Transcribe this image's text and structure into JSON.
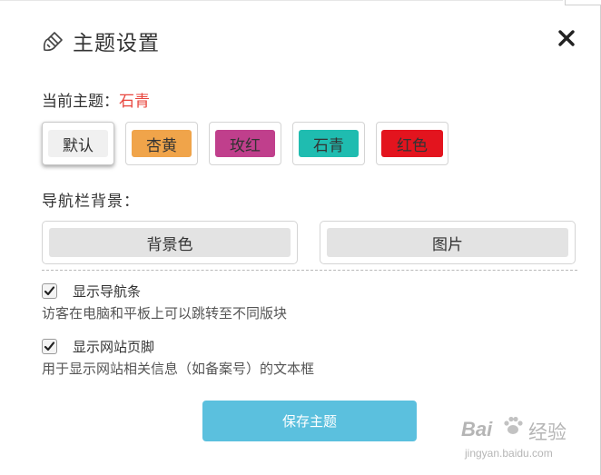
{
  "dialog": {
    "title": "主题设置",
    "icons": {
      "title": "paint-brush-icon",
      "close": "close-icon"
    }
  },
  "current_theme": {
    "label": "当前主题：",
    "value": "石青",
    "value_color": "#e8463e"
  },
  "themes": [
    {
      "label": "默认",
      "color": "#f0f0f0",
      "selected": true
    },
    {
      "label": "杏黄",
      "color": "#f0a44a",
      "selected": false
    },
    {
      "label": "玫红",
      "color": "#c03f8c",
      "selected": false
    },
    {
      "label": "石青",
      "color": "#1fbcb0",
      "selected": false
    },
    {
      "label": "红色",
      "color": "#e3141e",
      "selected": false
    }
  ],
  "nav_background": {
    "label": "导航栏背景：",
    "options": [
      {
        "label": "背景色"
      },
      {
        "label": "图片"
      }
    ]
  },
  "options": [
    {
      "label": "显示导航条",
      "checked": true,
      "description": "访客在电脑和平板上可以跳转至不同版块"
    },
    {
      "label": "显示网站页脚",
      "checked": true,
      "description": "用于显示网站相关信息（如备案号）的文本框"
    }
  ],
  "save_button": {
    "label": "保存主题",
    "color": "#5bc0de"
  },
  "watermark": {
    "brand": "Bai",
    "brand2": "经验",
    "url": "jingyan.baidu.com"
  }
}
